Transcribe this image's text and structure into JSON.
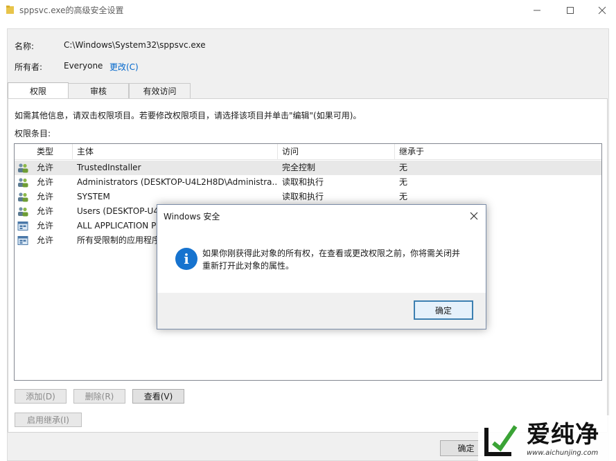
{
  "window": {
    "title": "sppsvc.exe的高级安全设置",
    "minimize_icon": "minimize-icon",
    "maximize_icon": "maximize-icon",
    "close_icon": "close-icon"
  },
  "info": {
    "name_label": "名称:",
    "name_value": "C:\\Windows\\System32\\sppsvc.exe",
    "owner_label": "所有者:",
    "owner_value": "Everyone",
    "change_link": "更改(C)"
  },
  "tabs": [
    {
      "label": "权限",
      "active": true
    },
    {
      "label": "审核",
      "active": false
    },
    {
      "label": "有效访问",
      "active": false
    }
  ],
  "panel": {
    "instructions": "如需其他信息，请双击权限项目。若要修改权限项目，请选择该项目并单击\"编辑\"(如果可用)。",
    "entries_label": "权限条目:"
  },
  "table": {
    "headers": [
      "类型",
      "主体",
      "访问",
      "继承于"
    ],
    "rows": [
      {
        "icon": "user-group-icon",
        "type": "允许",
        "principal": "TrustedInstaller",
        "access": "完全控制",
        "inherited": "无"
      },
      {
        "icon": "user-group-icon",
        "type": "允许",
        "principal": "Administrators (DESKTOP-U4L2H8D\\Administra...",
        "access": "读取和执行",
        "inherited": "无"
      },
      {
        "icon": "user-group-icon",
        "type": "允许",
        "principal": "SYSTEM",
        "access": "读取和执行",
        "inherited": "无"
      },
      {
        "icon": "user-group-icon",
        "type": "允许",
        "principal": "Users (DESKTOP-U4",
        "access": "",
        "inherited": ""
      },
      {
        "icon": "app-package-icon",
        "type": "允许",
        "principal": "ALL APPLICATION P",
        "access": "",
        "inherited": ""
      },
      {
        "icon": "app-package-icon",
        "type": "允许",
        "principal": "所有受限制的应用程序",
        "access": "",
        "inherited": ""
      }
    ]
  },
  "buttons": {
    "add": "添加(D)",
    "remove": "删除(R)",
    "view": "查看(V)",
    "enable_inheritance": "启用继承(I)",
    "ok": "确定"
  },
  "dialog": {
    "title": "Windows 安全",
    "message_line1": "如果你刚获得此对象的所有权，在查看或更改权限之前，你将需关闭并",
    "message_line2": "重新打开此对象的属性。",
    "ok": "确定",
    "icon": "info-icon"
  },
  "watermark": {
    "text": "爱纯净",
    "url": "www.aichunjing.com"
  },
  "colors": {
    "link": "#0066cc",
    "info_icon": "#1673cf",
    "annotation_arrow": "#e02020",
    "dialog_button_border": "#3c7fb1"
  }
}
